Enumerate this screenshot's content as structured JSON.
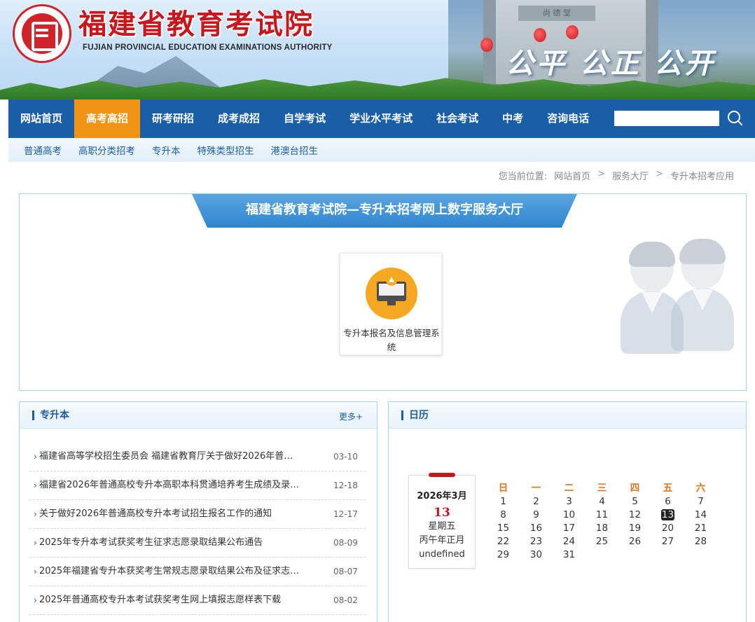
{
  "header": {
    "title": "福建省教育考试院",
    "subtitle": "FUJIAN PROVINCIAL EDUCATION EXAMINATIONS AUTHORITY",
    "slogan": "公平 公正 公开",
    "gate_sign": "尚 德 堂",
    "logo_icon": "seal-logo-icon"
  },
  "nav": {
    "items": [
      {
        "label": "网站首页"
      },
      {
        "label": "高考高招"
      },
      {
        "label": "研考研招"
      },
      {
        "label": "成考成招"
      },
      {
        "label": "自学考试"
      },
      {
        "label": "学业水平考试"
      },
      {
        "label": "社会考试"
      },
      {
        "label": "中考"
      },
      {
        "label": "咨询电话"
      }
    ],
    "active_index": 1,
    "search_placeholder": "",
    "search_icon": "search-icon"
  },
  "subnav": {
    "items": [
      "普通高考",
      "高职分类招考",
      "专升本",
      "特殊类型招生",
      "港澳台招生"
    ]
  },
  "breadcrumb": {
    "prefix": "您当前位置:",
    "items": [
      "网站首页",
      "服务大厅",
      "专升本招考应用"
    ],
    "separator": ">"
  },
  "hall": {
    "title": "福建省教育考试院—专升本招考网上数字服务大厅",
    "service": {
      "label": "专升本报名及信息管理系统",
      "icon": "computer-upload-icon"
    }
  },
  "news_panel": {
    "title": "专升本",
    "more": "更多+",
    "items": [
      {
        "title": "福建省高等学校招生委员会 福建省教育厅关于做好2026年普…",
        "date": "03-10"
      },
      {
        "title": "福建省2026年普通高校专升本高职本科贯通培养考生成绩及录…",
        "date": "12-18"
      },
      {
        "title": "关于做好2026年普通高校专升本考试招生报名工作的通知",
        "date": "12-17"
      },
      {
        "title": "2025年专升本考试获奖考生征求志愿录取结果公布通告",
        "date": "08-09"
      },
      {
        "title": "2025年福建省专升本获奖考生常规志愿录取结果公布及征求志…",
        "date": "08-07"
      },
      {
        "title": "2025年普通高校专升本考试获奖考生网上填报志愿样表下载",
        "date": "08-02"
      }
    ]
  },
  "calendar_panel": {
    "title": "日历",
    "card": {
      "year_month": "2026年3月",
      "day": "13",
      "weekday": "星期五",
      "lunar": "丙午年正月",
      "extra": "undefined"
    },
    "weekdays": [
      "日",
      "一",
      "二",
      "三",
      "四",
      "五",
      "六"
    ],
    "weeks": [
      [
        "1",
        "2",
        "3",
        "4",
        "5",
        "6",
        "7"
      ],
      [
        "8",
        "9",
        "10",
        "11",
        "12",
        "13",
        "14"
      ],
      [
        "15",
        "16",
        "17",
        "18",
        "19",
        "20",
        "21"
      ],
      [
        "22",
        "23",
        "24",
        "25",
        "26",
        "27",
        "28"
      ],
      [
        "29",
        "30",
        "31",
        "",
        "",
        "",
        ""
      ]
    ],
    "today": "13"
  },
  "colors": {
    "nav_bg": "#1a5ea8",
    "nav_active": "#f29413",
    "brand_red": "#c8161d",
    "accent_blue": "#2f86cf"
  }
}
